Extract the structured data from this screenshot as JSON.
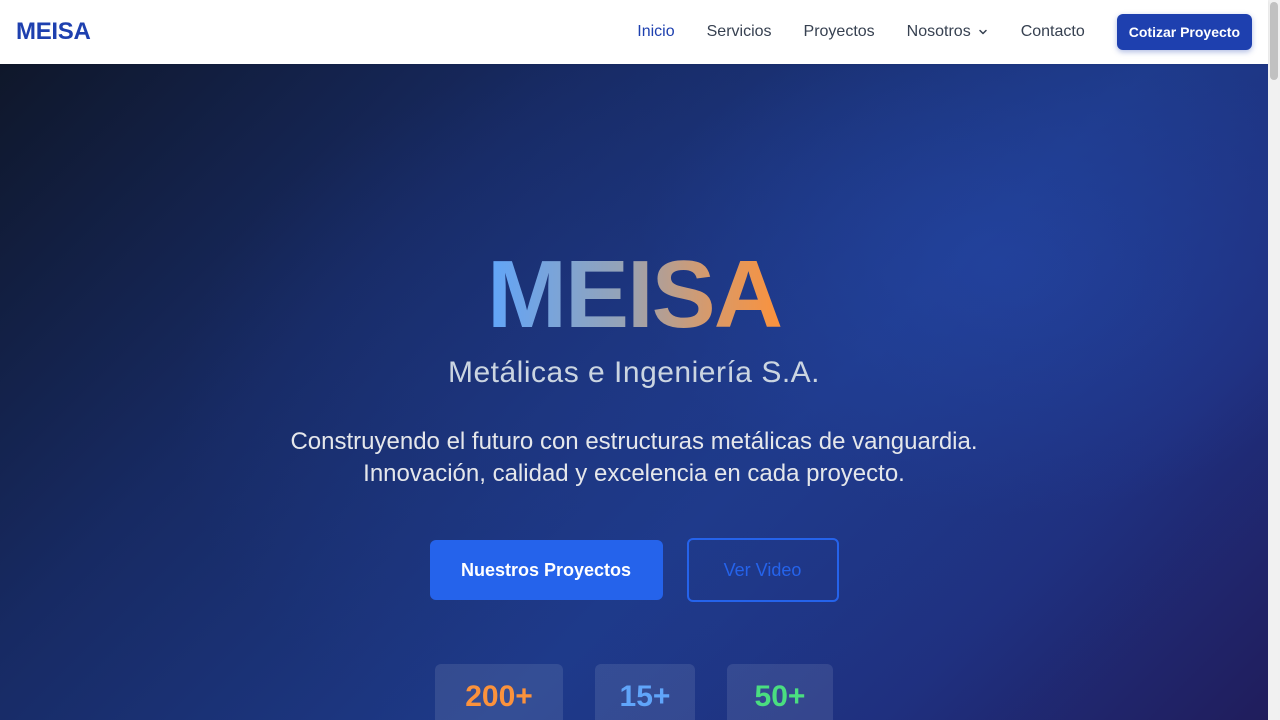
{
  "nav": {
    "brand": "MEISA",
    "links": [
      {
        "label": "Inicio",
        "active": true
      },
      {
        "label": "Servicios"
      },
      {
        "label": "Proyectos"
      },
      {
        "label": "Nosotros",
        "has_dropdown": true
      },
      {
        "label": "Contacto"
      }
    ],
    "cta_label": "Cotizar Proyecto"
  },
  "hero": {
    "title": "MEISA",
    "subtitle": "Metálicas e Ingeniería S.A.",
    "tagline_line1": "Construyendo el futuro con estructuras metálicas de vanguardia.",
    "tagline_line2": "Innovación, calidad y excelencia en cada proyecto.",
    "primary_button": "Nuestros Proyectos",
    "secondary_button": "Ver Video"
  },
  "stats": [
    {
      "value": "200+",
      "color": "#fb923c"
    },
    {
      "value": "15+",
      "color": "#60a5fa"
    },
    {
      "value": "50+",
      "color": "#4ade80"
    }
  ],
  "colors": {
    "brand": "#1e40af",
    "accent": "#2563eb",
    "title_gradient_start": "#60a5fa",
    "title_gradient_end": "#fb923c"
  },
  "icons": {
    "dropdown": "chevron-down-icon"
  }
}
